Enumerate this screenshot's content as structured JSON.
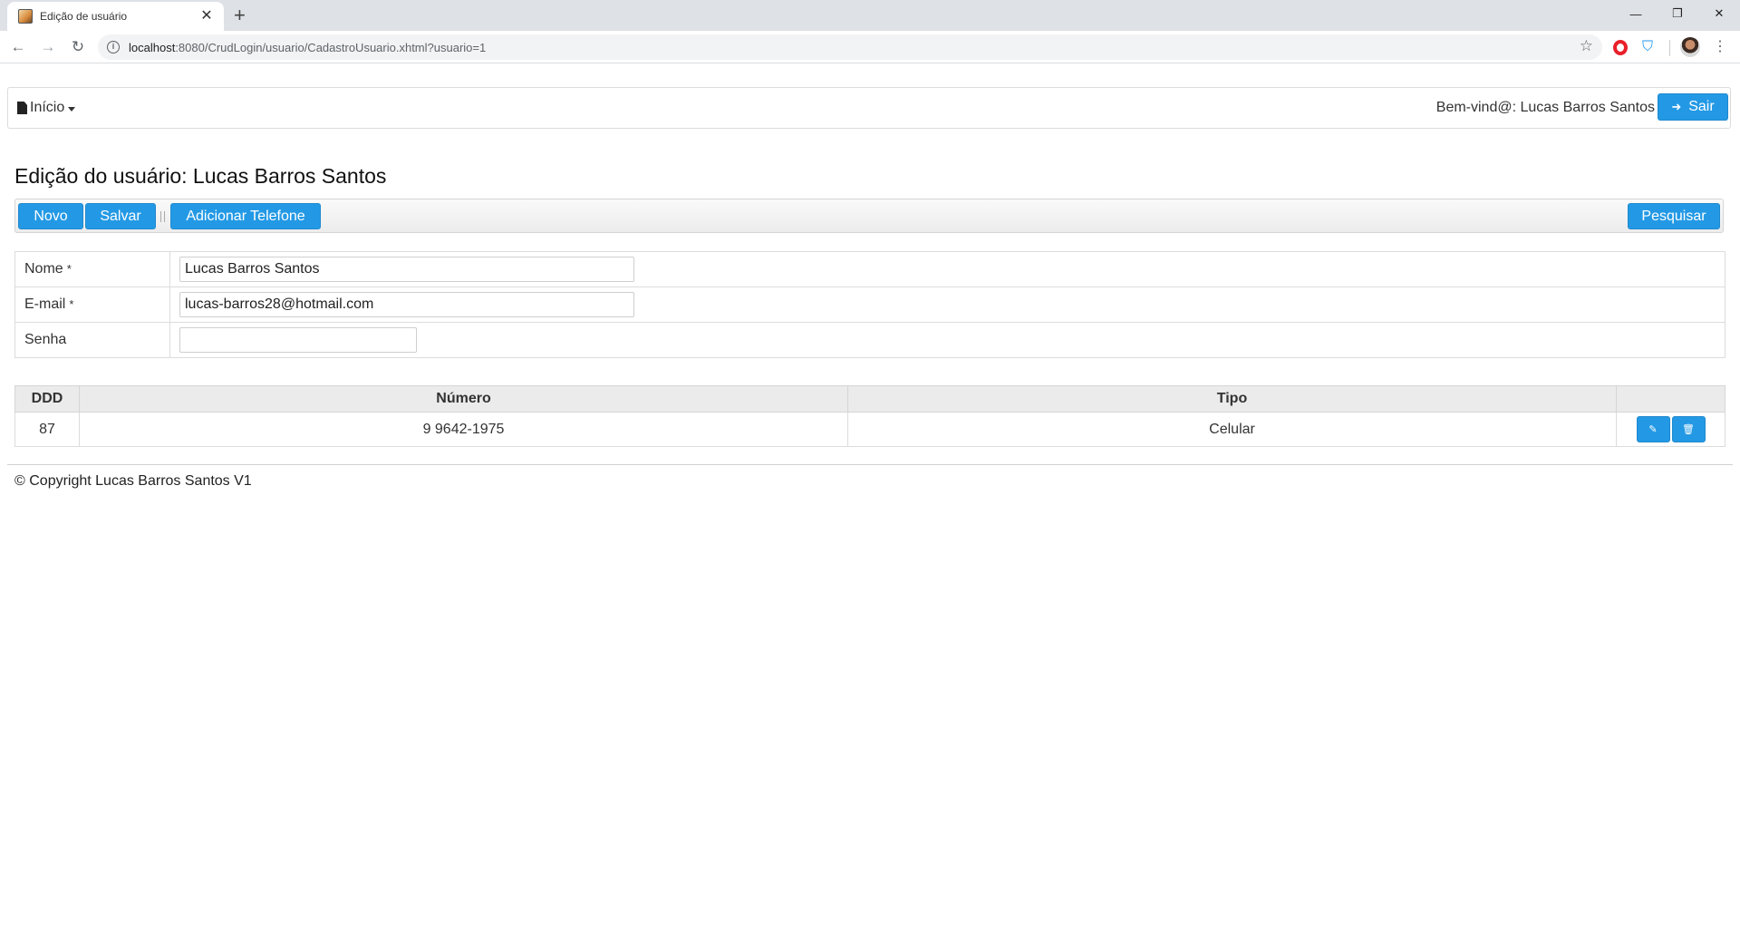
{
  "browser": {
    "tab_title": "Edição de usuário",
    "tab_close": "✕",
    "new_tab": "+",
    "url_host": "localhost",
    "url_path": ":8080/CrudLogin/usuario/CadastroUsuario.xhtml?usuario=1",
    "window_controls": [
      "—",
      "❐",
      "✕"
    ]
  },
  "nav": {
    "menu_label": "Início",
    "welcome": "Bem-vind@: Lucas Barros Santos",
    "logout_label": "Sair"
  },
  "page": {
    "title": "Edição do usuário: Lucas Barros Santos"
  },
  "toolbar": {
    "new_label": "Novo",
    "save_label": "Salvar",
    "add_phone_label": "Adicionar Telefone",
    "search_label": "Pesquisar"
  },
  "form": {
    "name_label": "Nome",
    "name_value": "Lucas Barros Santos",
    "email_label": "E-mail",
    "email_value": "lucas-barros28@hotmail.com",
    "password_label": "Senha",
    "password_value": "",
    "required_marker": "*"
  },
  "phones": {
    "headers": [
      "DDD",
      "Número",
      "Tipo",
      ""
    ],
    "rows": [
      {
        "ddd": "87",
        "numero": "9 9642-1975",
        "tipo": "Celular"
      }
    ]
  },
  "footer": {
    "text": "© Copyright Lucas Barros Santos V1"
  },
  "colors": {
    "accent": "#2399e5",
    "tabbar": "#dee1e6",
    "header_bg": "#ebebeb"
  }
}
